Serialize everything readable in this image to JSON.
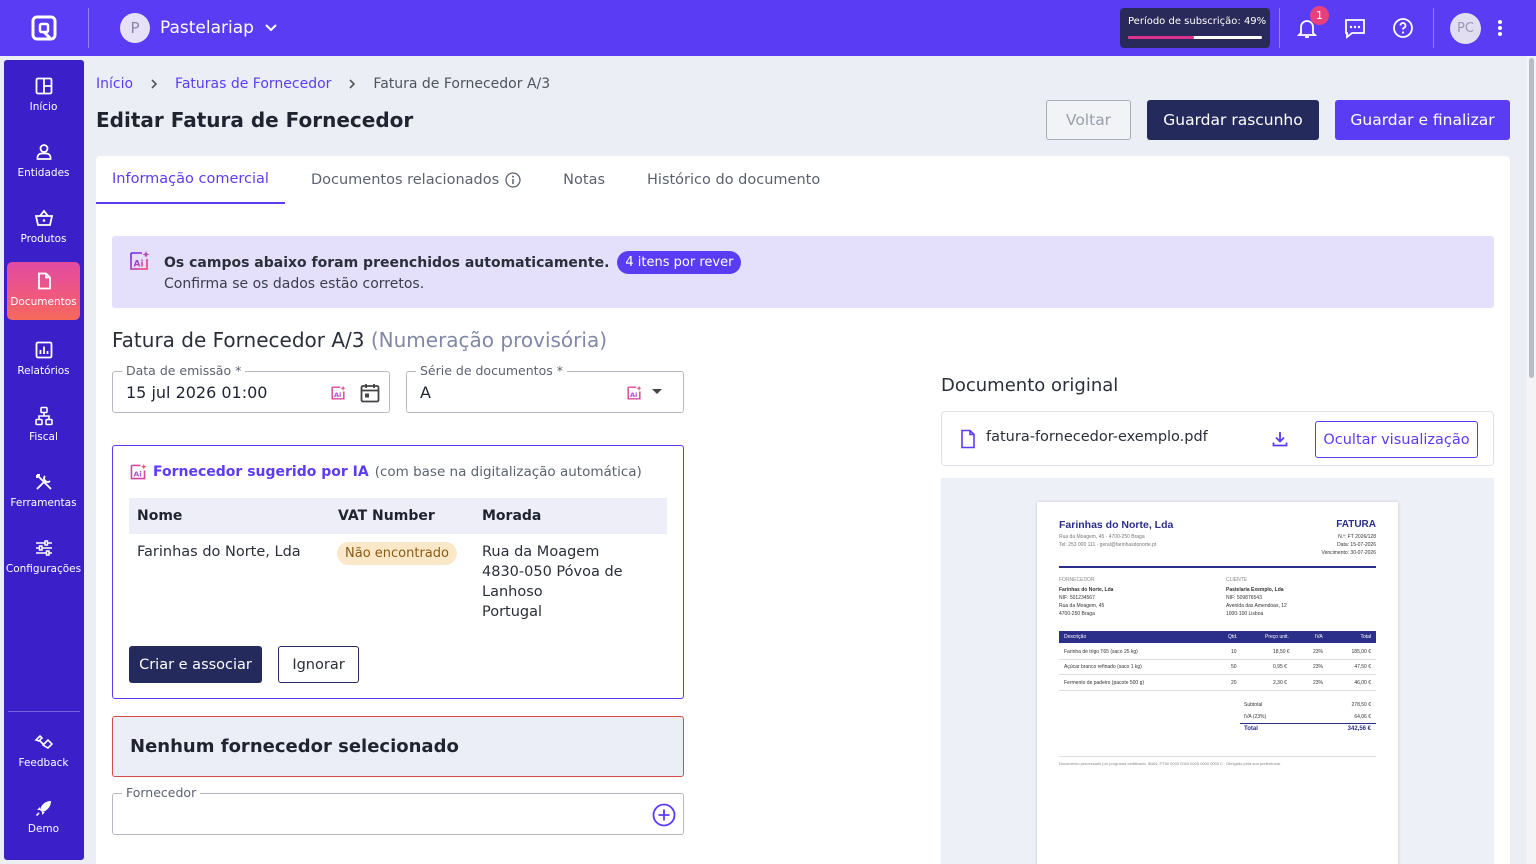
{
  "topbar": {
    "company_initial": "P",
    "company_name": "Pastelariap",
    "subscription_label": "Período de subscrição: 49%",
    "subscription_progress": 0.49,
    "notifications_count": "1",
    "user_initials": "PC"
  },
  "sidebar": {
    "items": [
      {
        "label": "Início",
        "icon": "grid-icon"
      },
      {
        "label": "Entidades",
        "icon": "user-icon"
      },
      {
        "label": "Produtos",
        "icon": "basket-icon"
      },
      {
        "label": "Documentos",
        "icon": "document-icon",
        "active": true
      },
      {
        "label": "Relatórios",
        "icon": "bar-chart-icon"
      },
      {
        "label": "Fiscal",
        "icon": "hierarchy-icon"
      },
      {
        "label": "Ferramentas",
        "icon": "tools-icon"
      },
      {
        "label": "Configurações",
        "icon": "sliders-icon"
      }
    ],
    "bottom": [
      {
        "label": "Feedback",
        "icon": "feedback-icon"
      },
      {
        "label": "Demo",
        "icon": "rocket-icon"
      }
    ]
  },
  "breadcrumb": {
    "home": "Início",
    "section": "Faturas de Fornecedor",
    "current": "Fatura de Fornecedor A/3"
  },
  "page_title": "Editar Fatura de Fornecedor",
  "actions": {
    "back": "Voltar",
    "draft": "Guardar rascunho",
    "finalize": "Guardar e finalizar"
  },
  "tabs": [
    "Informação comercial",
    "Documentos relacionados",
    "Notas",
    "Histórico do documento"
  ],
  "banner": {
    "title": "Os campos abaixo foram preenchidos automaticamente.",
    "pill": "4 itens por rever",
    "subtitle": "Confirma se os dados estão corretos."
  },
  "doc": {
    "title": "Fatura de Fornecedor A/3",
    "provisional": "(Numeração provisória)"
  },
  "fields": {
    "date_label": "Data de emissão *",
    "date_value": "15 jul 2026 01:00",
    "series_label": "Série de documentos *",
    "series_value": "A",
    "supplier_label": "Fornecedor"
  },
  "suggestion": {
    "title": "Fornecedor sugerido por IA",
    "note": "(com base na digitalização automática)",
    "headers": [
      "Nome",
      "VAT Number",
      "Morada"
    ],
    "name": "Farinhas do Norte, Lda",
    "vat_status": "Não encontrado",
    "address": [
      "Rua da Moagem",
      "4830-050 Póvoa de",
      "Lanhoso",
      "Portugal"
    ],
    "create_btn": "Criar e associar",
    "ignore_btn": "Ignorar"
  },
  "no_supplier": "Nenhum fornecedor selecionado",
  "original": {
    "title": "Documento original",
    "filename": "fatura-fornecedor-exemplo.pdf",
    "hide_btn": "Ocultar visualização"
  },
  "invoice_preview": {
    "company": "Farinhas do Norte, Lda",
    "company_addr": "Rua da Moagem, 45 · 4700-250 Braga",
    "company_contact": "Tel: 253 000 111 · geral@farinhasdonorte.pt",
    "doc_type": "FATURA",
    "number": "N.º: FT 2026/128",
    "date": "Data: 15-07-2026",
    "due": "Vencimento: 30-07-2026",
    "supplier_label": "FORNECEDOR",
    "supplier_lines": [
      "Farinhas do Norte, Lda",
      "NIF: 501234567",
      "Rua da Moagem, 45",
      "4700-250 Braga"
    ],
    "client_label": "CLIENTE",
    "client_lines": [
      "Pastelaria Exemplo, Lda",
      "NIF: 509876543",
      "Avenida das Amendoas, 12",
      "1000-100 Lisboa"
    ],
    "columns": [
      "Descrição",
      "Qtd.",
      "Preço unit.",
      "IVA",
      "Total"
    ],
    "rows": [
      [
        "Farinha de trigo T65 (saco 25 kg)",
        "10",
        "18,50 €",
        "23%",
        "185,00 €"
      ],
      [
        "Açúcar branco refinado (saco 1 kg)",
        "50",
        "0,95 €",
        "23%",
        "47,50 €"
      ],
      [
        "Fermento de padeiro (pacote 500 g)",
        "20",
        "2,30 €",
        "23%",
        "46,00 €"
      ]
    ],
    "subtotal_label": "Subtotal",
    "subtotal": "278,50 €",
    "vat_label": "IVA (23%)",
    "vat": "64,06 €",
    "total_label": "Total",
    "total": "342,56 €",
    "footer": "Documento processado por programa certificado. IBAN: PT50 0000 0000 0000 0000 0000 0 · Obrigado pela sua preferência."
  }
}
